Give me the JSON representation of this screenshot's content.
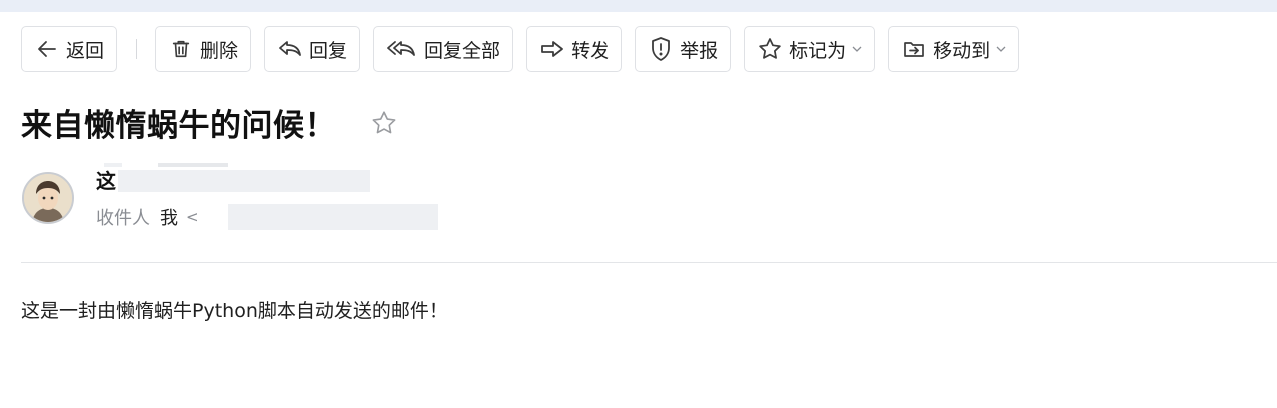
{
  "toolbar": {
    "back": {
      "label": "返回",
      "icon": "arrow-left-icon"
    },
    "delete": {
      "label": "删除",
      "icon": "trash-icon"
    },
    "reply": {
      "label": "回复",
      "icon": "reply-icon"
    },
    "reply_all": {
      "label": "回复全部",
      "icon": "reply-all-icon"
    },
    "forward": {
      "label": "转发",
      "icon": "forward-icon"
    },
    "report": {
      "label": "举报",
      "icon": "shield-alert-icon"
    },
    "mark_as": {
      "label": "标记为",
      "icon": "star-outline-icon"
    },
    "move_to": {
      "label": "移动到",
      "icon": "folder-move-icon"
    }
  },
  "email": {
    "subject": "来自懒惰蜗牛的问候！",
    "sender_initial": "这",
    "recipient_label": "收件人",
    "recipient_me": "我",
    "recipient_bracket": "<",
    "body": "这是一封由懒惰蜗牛Python脚本自动发送的邮件！"
  },
  "colors": {
    "border": "#dfe1e5",
    "icon": "#3c3c3c",
    "muted": "#8a8d93",
    "star": "#9a9ca0"
  }
}
